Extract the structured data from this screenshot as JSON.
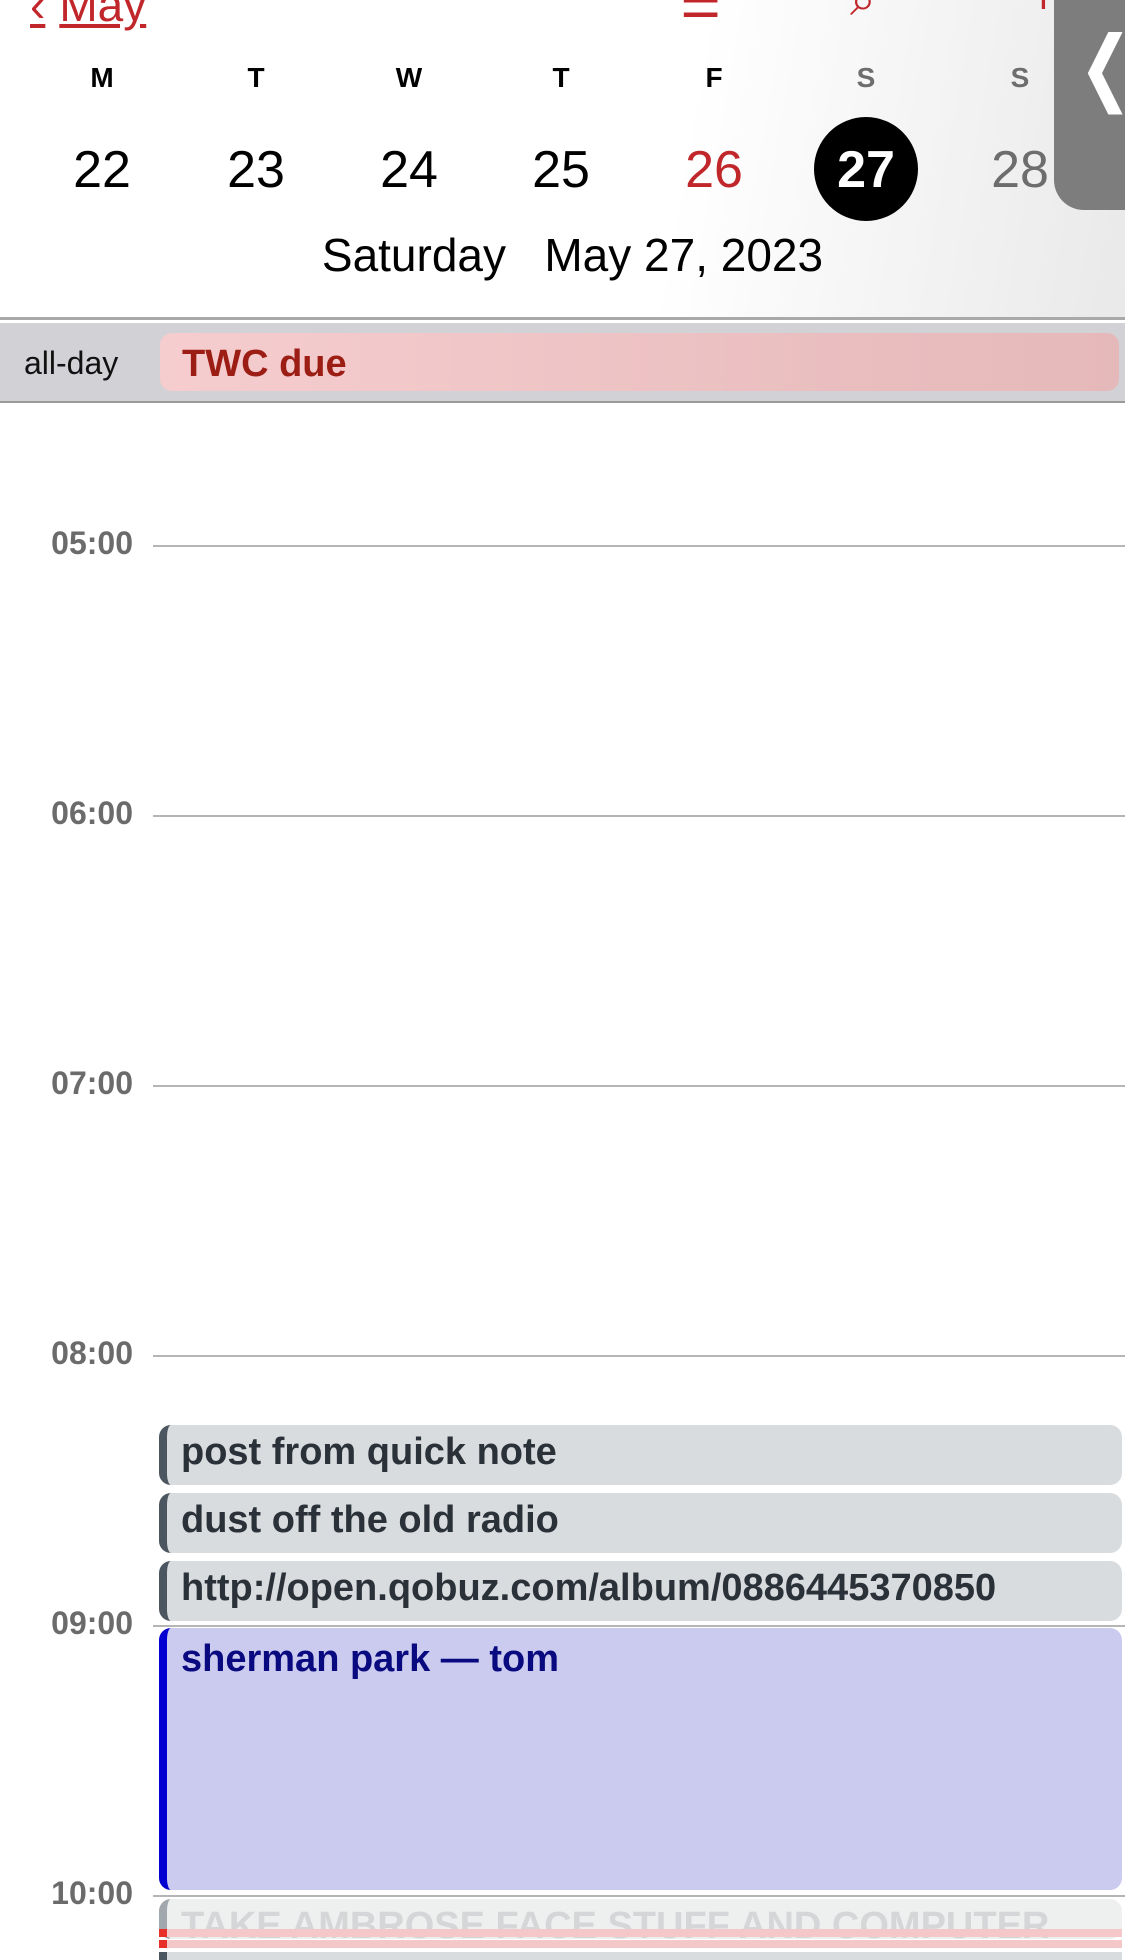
{
  "nav": {
    "back_label": "May",
    "icons": [
      "chevron-left-icon",
      "list-icon",
      "search-icon",
      "add-icon"
    ]
  },
  "week": {
    "letters": [
      "M",
      "T",
      "W",
      "T",
      "F",
      "S",
      "S"
    ],
    "numbers": [
      "22",
      "23",
      "24",
      "25",
      "26",
      "27",
      "28"
    ],
    "selected": "27"
  },
  "date_title": {
    "weekday": "Saturday",
    "date": "May 27, 2023"
  },
  "side_tab": {
    "glyph": "❬"
  },
  "allday": {
    "label": "all-day",
    "event": "TWC due"
  },
  "hours": [
    "05:00",
    "06:00",
    "07:00",
    "08:00",
    "09:00",
    "10:00"
  ],
  "events": [
    {
      "title": "post from quick note"
    },
    {
      "title": "dust off the old radio"
    },
    {
      "title": "http://open.qobuz.com/album/0886445370850"
    },
    {
      "title": "sherman park — tom"
    },
    {
      "title": "TAKE AMBROSE FACE STUFF AND COMPUTER"
    }
  ],
  "colors": {
    "accent": "#c0262a",
    "blue_event": "#0000d0",
    "gray_event": "#4b5660"
  }
}
